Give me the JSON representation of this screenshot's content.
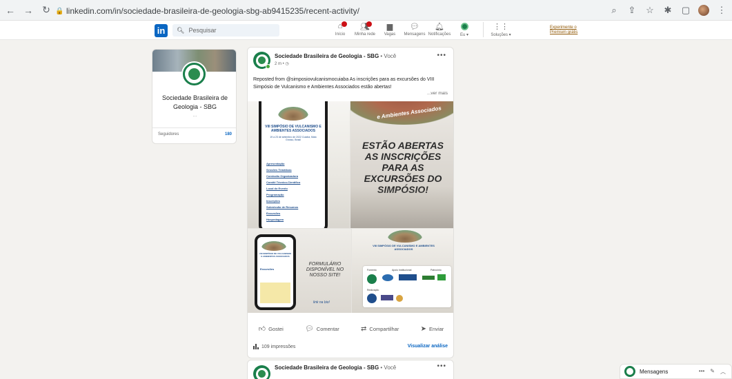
{
  "browser": {
    "url": "linkedin.com/in/sociedade-brasileira-de-geologia-sbg-ab9415235/recent-activity/",
    "icons": [
      "back-icon",
      "forward-icon",
      "reload-icon",
      "lock-icon",
      "zoom-icon",
      "share-icon",
      "star-icon",
      "extensions-icon",
      "sidebar-icon",
      "profile-avatar",
      "menu-icon"
    ]
  },
  "linkedin_nav": {
    "logo": "in",
    "search_placeholder": "Pesquisar",
    "items": [
      {
        "label": "Início",
        "icon": "home-icon",
        "badge": true
      },
      {
        "label": "Minha rede",
        "icon": "network-icon",
        "badge": true
      },
      {
        "label": "Vagas",
        "icon": "briefcase-icon",
        "badge": false
      },
      {
        "label": "Mensagens",
        "icon": "messaging-icon",
        "badge": false
      },
      {
        "label": "Notificações",
        "icon": "bell-icon",
        "badge": false
      },
      {
        "label": "Eu ▾",
        "icon": "me-avatar-icon",
        "badge": false
      }
    ],
    "solutions_label": "Soluções ▾",
    "premium_line1": "Experimente o",
    "premium_line2": "Premium grátis"
  },
  "profile_card": {
    "name": "Sociedade Brasileira de Geologia - SBG",
    "dots": "...",
    "stat_label": "Seguidores",
    "stat_value": "180"
  },
  "post": {
    "author": "Sociedade Brasileira de Geologia - SBG",
    "author_suffix": " • Você",
    "time": "2 m • ",
    "more": "•••",
    "text": "Reposted from @simposiovulcanismocuiaba As inscrições para as excursões do VIII Simpósio de Vulcanismo e Ambientes Associados estão abertas!",
    "see_more": "...ver mais",
    "media": {
      "phone_title": "VIII SIMPÓSIO DE VULCANISMO E AMBIENTES ASSOCIADOS",
      "phone_sub": "19 a 23 de setembro de 2022 Cuiabá, Mato Grosso, Brasil",
      "menu_items": [
        "Apresentação",
        "Sessões Temáticas",
        "Comissão Organizadora",
        "Comitê Técnico-Científico",
        "Local do Evento",
        "Programação",
        "Inscrições",
        "Submissão de Resumos",
        "Excursões",
        "Hospedagem"
      ],
      "banner_text": "e Ambientes Associados",
      "big_text": "ESTÃO ABERTAS AS INSCRIÇÕES PARA AS EXCURSÕES DO SIMPÓSIO!",
      "small_phone_title": "VIII SIMPÓSIO DE VULCANISMO E AMBIENTES ASSOCIADOS",
      "small_phone_link": "Excursões",
      "form_text": "FORMULÁRIO DISPONÍVEL NO NOSSO SITE!",
      "form_note": "link na bio!",
      "d_title": "VIII SIMPÓSIO DE VULCANISMO E AMBIENTES ASSOCIADOS",
      "sponsor_labels": [
        "Fomento",
        "Apoio Institucional",
        "Patrocínio",
        "Realização"
      ]
    },
    "actions": [
      {
        "label": "Gostei",
        "icon": "like-icon"
      },
      {
        "label": "Comentar",
        "icon": "comment-icon"
      },
      {
        "label": "Compartilhar",
        "icon": "repost-icon"
      },
      {
        "label": "Enviar",
        "icon": "send-icon"
      }
    ],
    "impressions": "109 impressões",
    "analytics": "Visualizar análise"
  },
  "post2": {
    "author": "Sociedade Brasileira de Geologia - SBG",
    "author_suffix": " • Você",
    "more": "•••"
  },
  "messaging": {
    "label": "Mensagens",
    "more": "•••",
    "compose": "✎",
    "collapse": "︿"
  },
  "colors": {
    "brand_blue": "#0a66c2",
    "sbg_green": "#1a7f4b",
    "notification_red": "#cc1016",
    "premium_gold": "#915907"
  }
}
